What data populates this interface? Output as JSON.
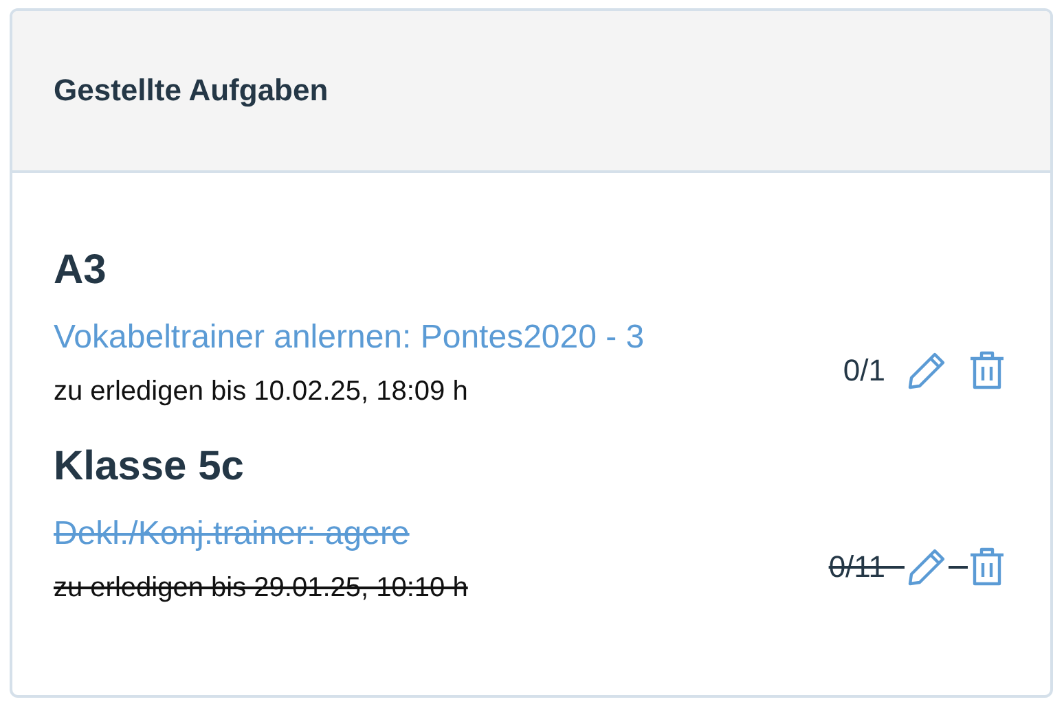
{
  "panel": {
    "title": "Gestellte Aufgaben"
  },
  "groups": [
    {
      "name": "A3",
      "tasks": [
        {
          "title": "Vokabeltrainer anlernen: Pontes2020 - 3",
          "due": "zu erledigen bis 10.02.25, 18:09 h",
          "count": "0/1",
          "struck": false
        }
      ]
    },
    {
      "name": "Klasse 5c",
      "tasks": [
        {
          "title": "Dekl./Konj.trainer: agere",
          "due": "zu erledigen bis 29.01.25, 10:10 h",
          "count": "0/11",
          "struck": true
        }
      ]
    }
  ]
}
